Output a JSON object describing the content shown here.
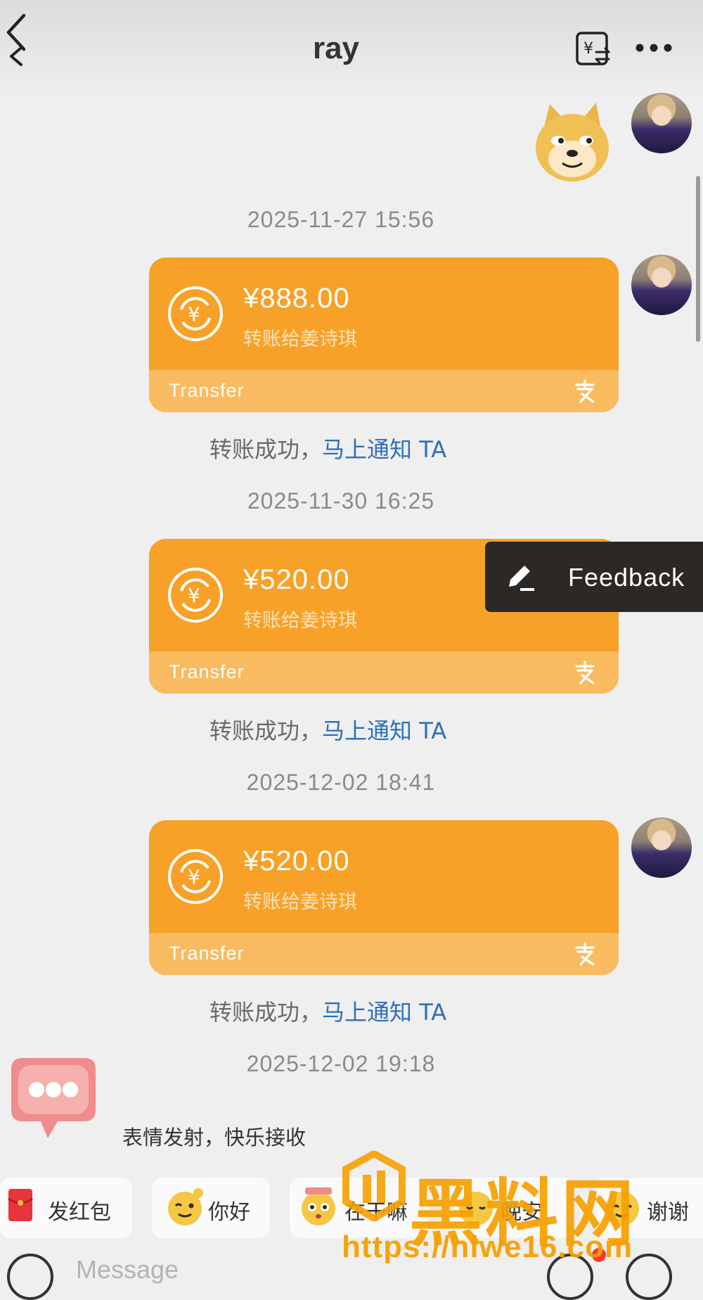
{
  "header": {
    "title": "ray",
    "back_icon": "chevron-left-icon",
    "translate_icon": "currency-exchange-icon",
    "more_icon": "more-dots-icon"
  },
  "messages": [
    {
      "timestamp": "2025-11-27 15:56",
      "amount": "¥888.00",
      "recipient": "转账给姜诗琪",
      "footer": "Transfer",
      "status_prefix": "转账成功，",
      "status_link": "马上通知 TA"
    },
    {
      "timestamp": "2025-11-30 16:25",
      "amount": "¥520.00",
      "recipient": "转账给姜诗琪",
      "footer": "Transfer",
      "status_prefix": "转账成功，",
      "status_link": "马上通知 TA"
    },
    {
      "timestamp": "2025-12-02 18:41",
      "amount": "¥520.00",
      "recipient": "转账给姜诗琪",
      "footer": "Transfer",
      "status_prefix": "转账成功，",
      "status_link": "马上通知 TA"
    }
  ],
  "last_timestamp": "2025-12-02 19:18",
  "feedback": {
    "label": "Feedback",
    "icon": "edit-pencil-icon"
  },
  "sticker_caption": "表情发射，快乐接收",
  "quick_replies": [
    {
      "label": "发红包",
      "icon": "red-packet-icon"
    },
    {
      "label": "你好",
      "icon": "wink-face-icon"
    },
    {
      "label": "在干嘛",
      "icon": "curious-face-icon"
    },
    {
      "label": "晚安",
      "icon": "sleep-face-icon"
    },
    {
      "label": "谢谢",
      "icon": "thanks-face-icon"
    }
  ],
  "composer": {
    "placeholder": "Message",
    "voice_icon": "voice-icon",
    "emoji_icon": "emoji-icon",
    "plus_icon": "plus-icon"
  },
  "watermark": {
    "text": "黑料网",
    "url": "https://hlwe16.com"
  },
  "colors": {
    "card": "#f7a128",
    "card_footer": "#f9bb60",
    "link": "#2e6fb8",
    "accent": "#f6a000"
  }
}
